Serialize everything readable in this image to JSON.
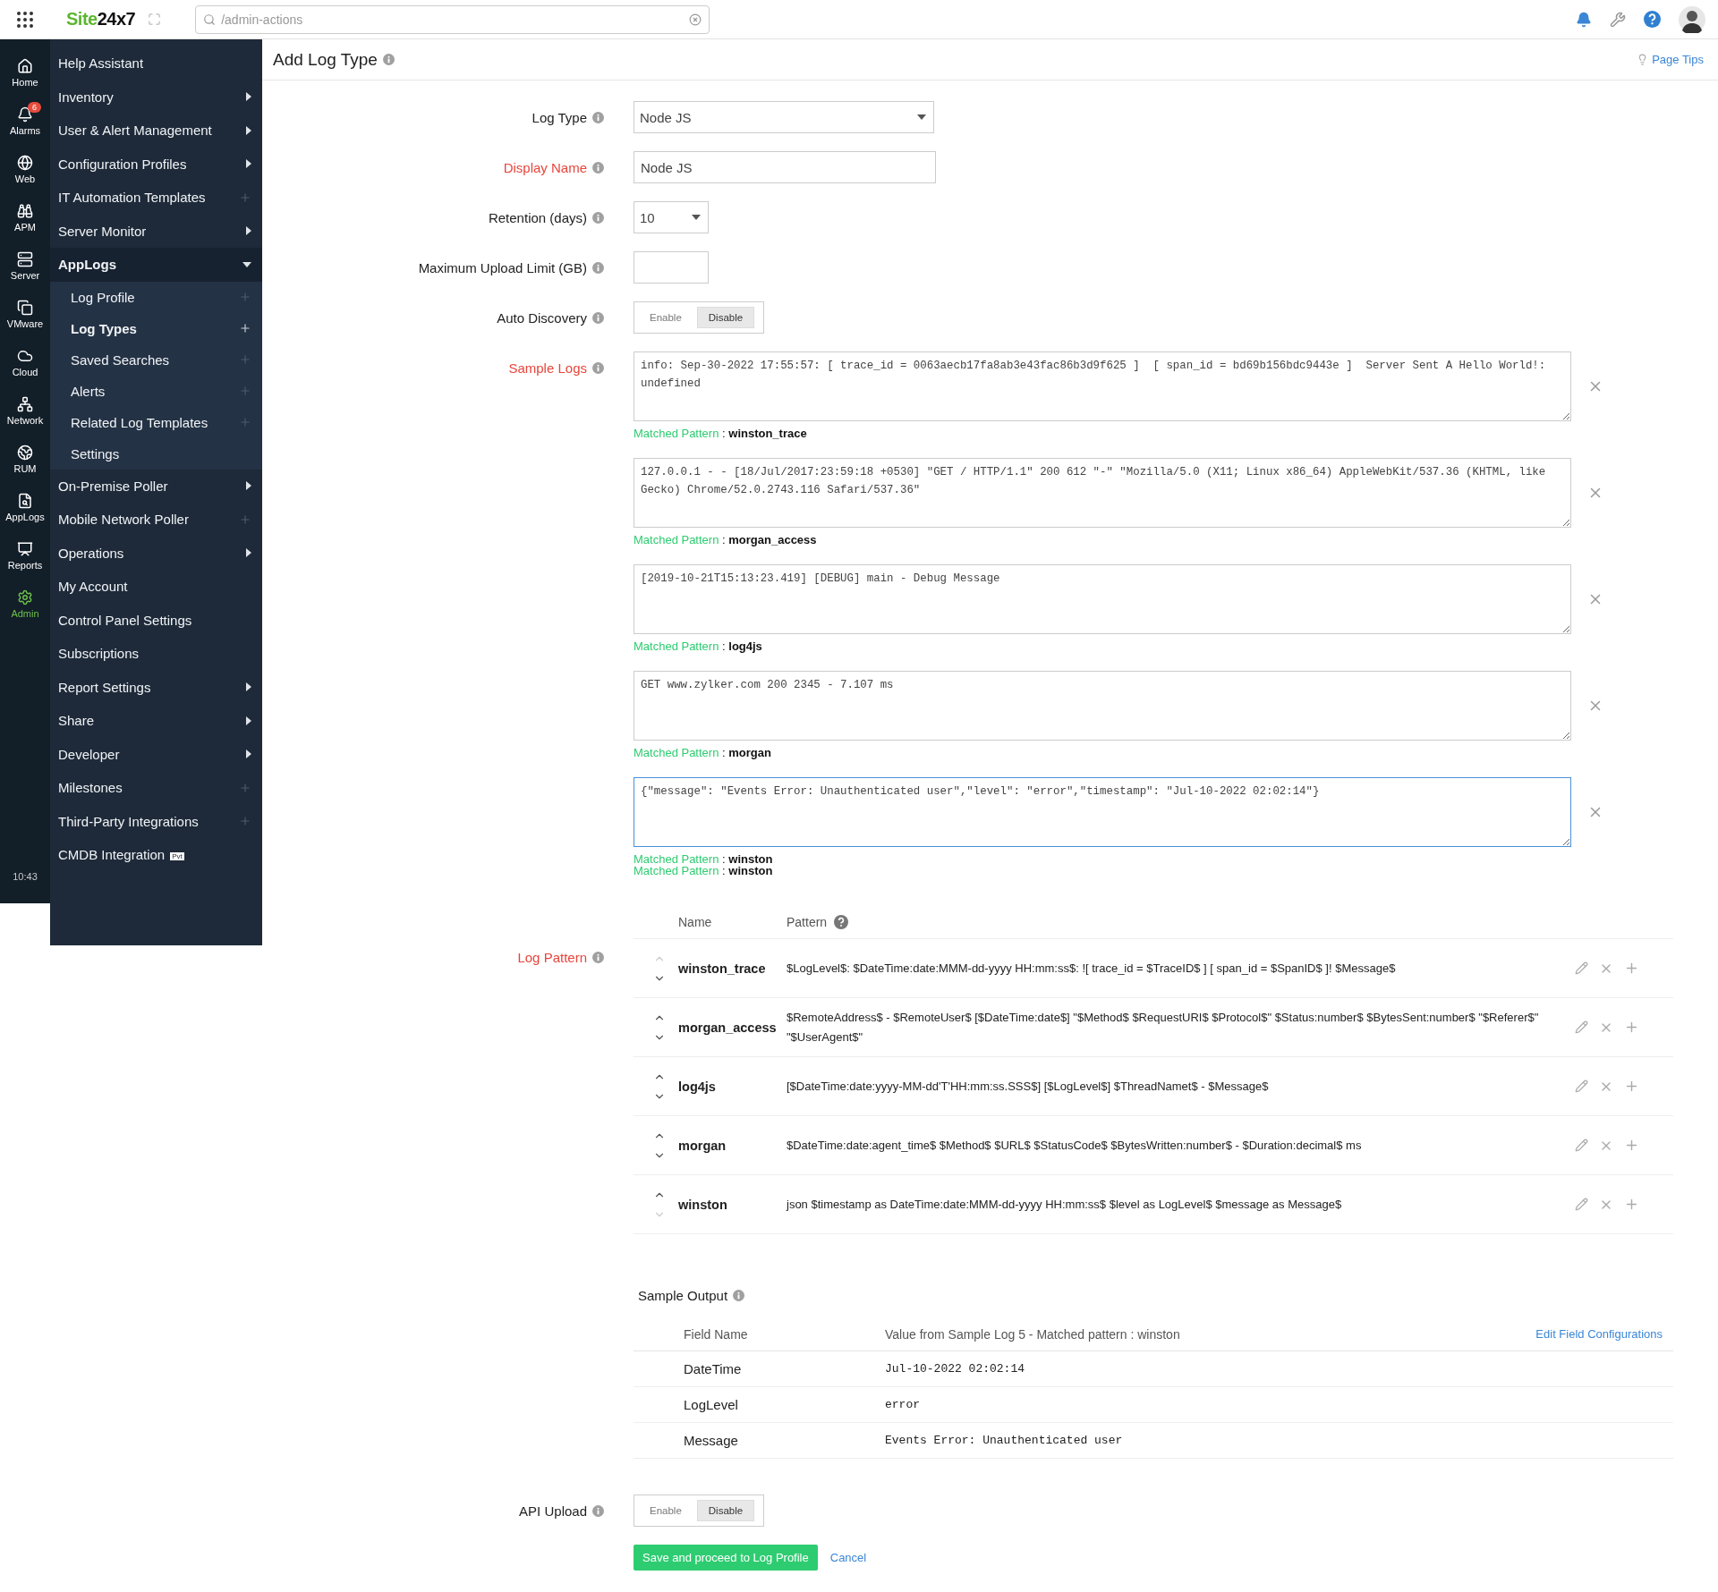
{
  "header": {
    "logo": {
      "part1": "Site",
      "part2": "24x7"
    },
    "search": {
      "placeholder": "/admin-actions"
    }
  },
  "rail": {
    "items": [
      {
        "label": "Home",
        "selected": false
      },
      {
        "label": "Alarms",
        "selected": false,
        "badge": "6"
      },
      {
        "label": "Web",
        "selected": false
      },
      {
        "label": "APM",
        "selected": false
      },
      {
        "label": "Server",
        "selected": false
      },
      {
        "label": "VMware",
        "selected": false
      },
      {
        "label": "Cloud",
        "selected": false
      },
      {
        "label": "Network",
        "selected": false
      },
      {
        "label": "RUM",
        "selected": false
      },
      {
        "label": "AppLogs",
        "selected": false
      },
      {
        "label": "Reports",
        "selected": false
      },
      {
        "label": "Admin",
        "selected": true
      }
    ],
    "time": "10:43"
  },
  "menu": {
    "items": [
      {
        "label": "Help Assistant",
        "kind": "plain"
      },
      {
        "label": "Inventory",
        "kind": "arrow"
      },
      {
        "label": "User & Alert Management",
        "kind": "arrow"
      },
      {
        "label": "Configuration Profiles",
        "kind": "arrow"
      },
      {
        "label": "IT Automation Templates",
        "kind": "plus"
      },
      {
        "label": "Server Monitor",
        "kind": "arrow"
      },
      {
        "label": "AppLogs",
        "kind": "group",
        "expanded": true,
        "children": [
          {
            "label": "Log Profile",
            "kind": "plus",
            "selected": false
          },
          {
            "label": "Log Types",
            "kind": "plus",
            "selected": true
          },
          {
            "label": "Saved Searches",
            "kind": "plus",
            "selected": false
          },
          {
            "label": "Alerts",
            "kind": "plus",
            "selected": false
          },
          {
            "label": "Related Log Templates",
            "kind": "plus",
            "selected": false
          },
          {
            "label": "Settings",
            "kind": "plain",
            "selected": false
          }
        ]
      },
      {
        "label": "On-Premise Poller",
        "kind": "arrow"
      },
      {
        "label": "Mobile Network Poller",
        "kind": "plus"
      },
      {
        "label": "Operations",
        "kind": "arrow"
      },
      {
        "label": "My Account",
        "kind": "plain"
      },
      {
        "label": "Control Panel Settings",
        "kind": "plain"
      },
      {
        "label": "Subscriptions",
        "kind": "plain"
      },
      {
        "label": "Report Settings",
        "kind": "arrow"
      },
      {
        "label": "Share",
        "kind": "arrow"
      },
      {
        "label": "Developer",
        "kind": "arrow"
      },
      {
        "label": "Milestones",
        "kind": "plus"
      },
      {
        "label": "Third-Party Integrations",
        "kind": "plus"
      },
      {
        "label": "CMDB Integration",
        "kind": "tag",
        "tag": "Pvt"
      }
    ]
  },
  "page": {
    "title": "Add Log Type",
    "tips": "Page Tips"
  },
  "fields": [
    {
      "kind": "select",
      "label": "Log Type",
      "required": false,
      "value": "Node JS"
    },
    {
      "kind": "text",
      "label": "Display Name",
      "required": true,
      "value": "Node JS"
    },
    {
      "kind": "small-select",
      "label": "Retention (days)",
      "required": false,
      "value": "10"
    },
    {
      "kind": "input",
      "label": "Maximum Upload Limit (GB)",
      "required": false
    },
    {
      "kind": "toggle",
      "label": "Auto Discovery",
      "required": false,
      "options": [
        {
          "label": "Enable",
          "selected": false
        },
        {
          "label": "Disable",
          "selected": true
        }
      ]
    }
  ],
  "sample_logs": {
    "label": "Sample Logs",
    "required": true,
    "items": [
      {
        "text": "info: Sep-30-2022 17:55:57: [ trace_id = 0063aecb17fa8ab3e43fac86b3d9f625 ]  [ span_id = bd69b156bdc9443e ]  Server Sent A Hello World!: undefined",
        "focused": false,
        "match_label": "Matched Pattern",
        "separator": ":",
        "match": "winston_trace"
      },
      {
        "text": "127.0.0.1 - - [18/Jul/2017:23:59:18 +0530] \"GET / HTTP/1.1\" 200 612 \"-\" \"Mozilla/5.0 (X11; Linux x86_64) AppleWebKit/537.36 (KHTML, like Gecko) Chrome/52.0.2743.116 Safari/537.36\"",
        "focused": false,
        "match_label": "Matched Pattern",
        "separator": ":",
        "match": "morgan_access"
      },
      {
        "text": "[2019-10-21T15:13:23.419] [DEBUG] main - Debug Message",
        "focused": false,
        "match_label": "Matched Pattern",
        "separator": ":",
        "match": "log4js"
      },
      {
        "text": "GET www.zylker.com 200 2345 - 7.107 ms",
        "focused": false,
        "match_label": "Matched Pattern",
        "separator": ":",
        "match": "morgan"
      },
      {
        "text": "{\"message\": \"Events Error: Unauthenticated user\",\"level\": \"error\",\"timestamp\": \"Jul-10-2022 02:02:14\"}",
        "focused": true,
        "match_label": "Matched Pattern",
        "separator": ":",
        "match": "winston"
      }
    ],
    "extra_matches": [
      {
        "label": "Matched Pattern",
        "separator": ":",
        "value": "winston"
      }
    ]
  },
  "log_pattern": {
    "label": "Log Pattern",
    "required": true,
    "columns": [
      "Name",
      "Pattern"
    ],
    "rows": [
      {
        "name": "winston_trace",
        "pattern": "$LogLevel$: $DateTime:date:MMM-dd-yyyy HH:mm:ss$: ![ trace_id = $TraceID$ ] [ span_id = $SpanID$ ]! $Message$",
        "up_disabled": true,
        "down_disabled": false
      },
      {
        "name": "morgan_access",
        "pattern": "$RemoteAddress$ - $RemoteUser$ [$DateTime:date$] \"$Method$ $RequestURI$ $Protocol$\" $Status:number$ $BytesSent:number$ \"$Referer$\" \"$UserAgent$\"",
        "up_disabled": false,
        "down_disabled": false
      },
      {
        "name": "log4js",
        "pattern": "[$DateTime:date:yyyy-MM-dd'T'HH:mm:ss.SSS$] [$LogLevel$] $ThreadNamet$ - $Message$",
        "up_disabled": false,
        "down_disabled": false
      },
      {
        "name": "morgan",
        "pattern": "$DateTime:date:agent_time$ $Method$ $URL$ $StatusCode$ $BytesWritten:number$ - $Duration:decimal$ ms",
        "up_disabled": false,
        "down_disabled": false
      },
      {
        "name": "winston",
        "pattern": "json $timestamp as DateTime:date:MMM-dd-yyyy HH:mm:ss$ $level as LogLevel$ $message as Message$",
        "up_disabled": false,
        "down_disabled": true
      }
    ]
  },
  "sample_output": {
    "title": "Sample Output",
    "columns": [
      "Field Name",
      "Value from Sample Log 5 - Matched pattern : winston"
    ],
    "link": "Edit Field Configurations",
    "rows": [
      {
        "field": "DateTime",
        "value": "Jul-10-2022 02:02:14"
      },
      {
        "field": "LogLevel",
        "value": "error"
      },
      {
        "field": "Message",
        "value": "Events Error: Unauthenticated user"
      }
    ]
  },
  "api_upload": {
    "label": "API Upload",
    "required": false,
    "options": [
      {
        "label": "Enable",
        "selected": false
      },
      {
        "label": "Disable",
        "selected": true
      }
    ]
  },
  "actions": {
    "save": "Save and proceed to Log Profile",
    "cancel": "Cancel"
  }
}
